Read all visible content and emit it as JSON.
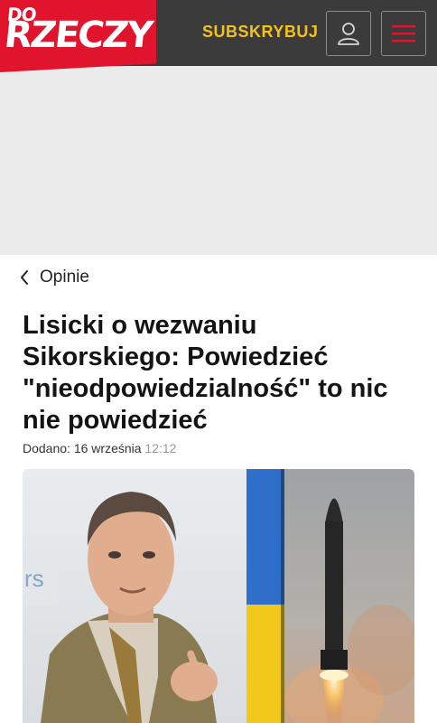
{
  "header": {
    "logo_top": "DO",
    "logo_main": "RZECZY",
    "subscribe_label": "SUBSKRYBUJ",
    "user_icon": "user-icon",
    "menu_icon": "hamburger-menu-icon",
    "brand_color": "#e1142e",
    "subscribe_color": "#f4c21b"
  },
  "breadcrumb": {
    "label": "Opinie",
    "icon": "chevron-left-icon"
  },
  "article": {
    "title": "Lisicki o wezwaniu Sikorskiego: Powiedzieć \"nieodpowiedzialność\" to nic nie powiedzieć",
    "date_prefix": "Dodano:",
    "date": "16 września",
    "time": "12:12"
  }
}
